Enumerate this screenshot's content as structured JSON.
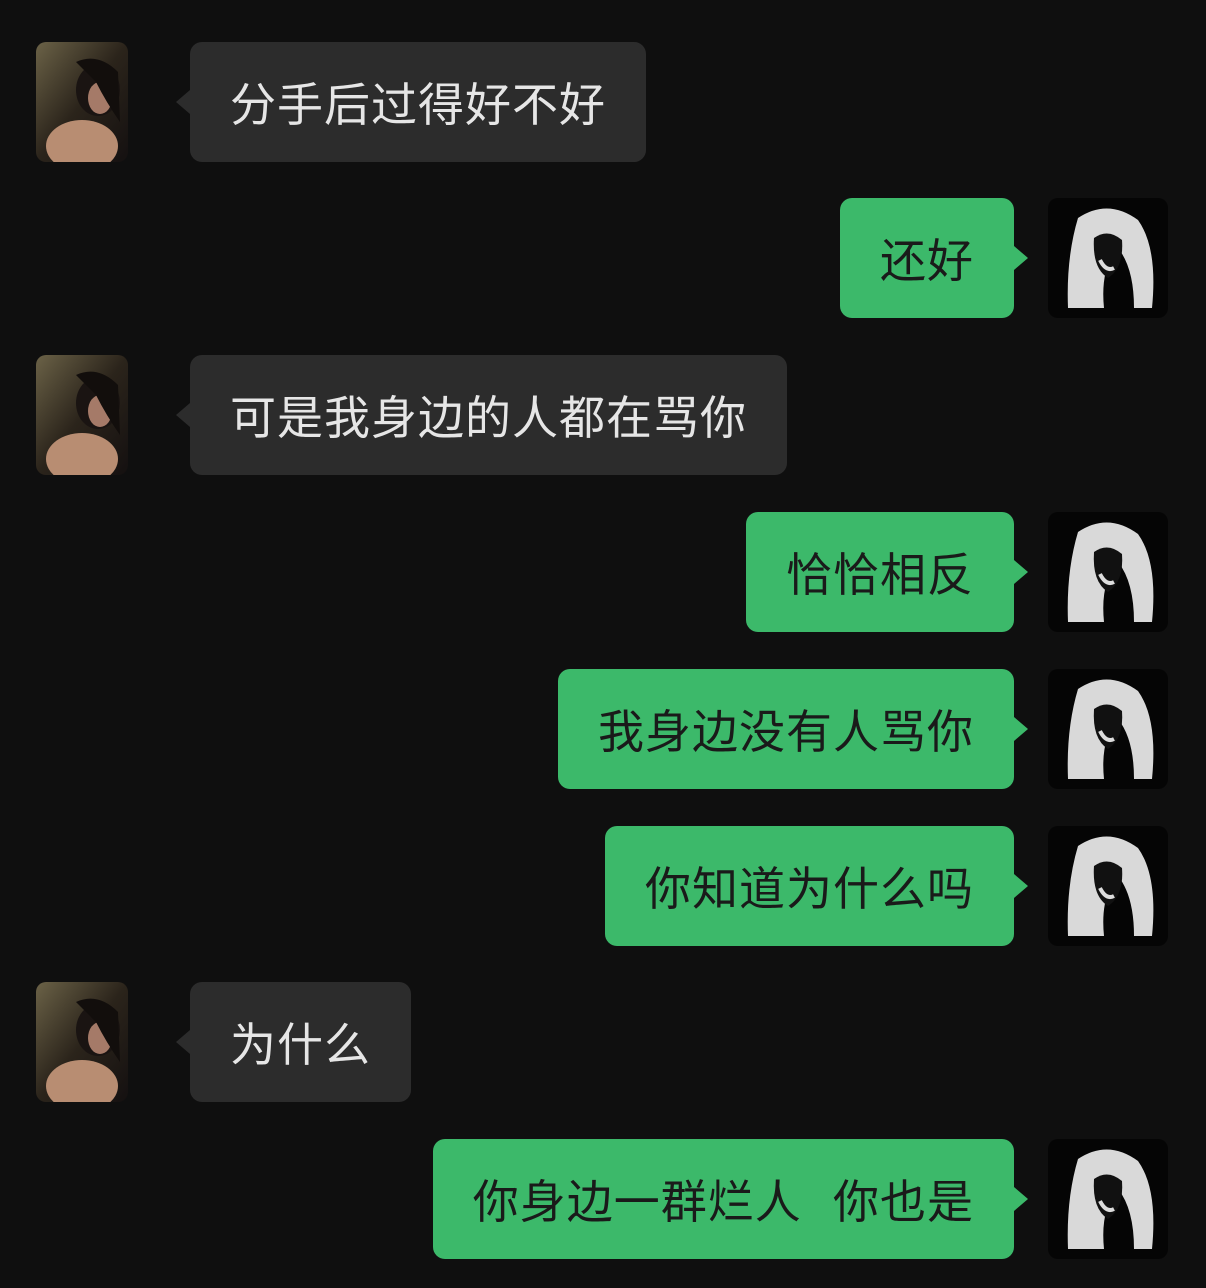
{
  "messages": [
    {
      "sender": "other",
      "text": "分手后过得好不好"
    },
    {
      "sender": "self",
      "text": "还好"
    },
    {
      "sender": "other",
      "text": "可是我身边的人都在骂你"
    },
    {
      "sender": "self",
      "text": "恰恰相反"
    },
    {
      "sender": "self",
      "text": "我身边没有人骂你"
    },
    {
      "sender": "self",
      "text": "你知道为什么吗"
    },
    {
      "sender": "other",
      "text": "为什么"
    },
    {
      "sender": "self",
      "text": "你身边一群烂人  你也是"
    }
  ],
  "colors": {
    "background": "#0f0f0f",
    "incoming_bubble": "#2c2c2c",
    "outgoing_bubble": "#3cb96a"
  }
}
